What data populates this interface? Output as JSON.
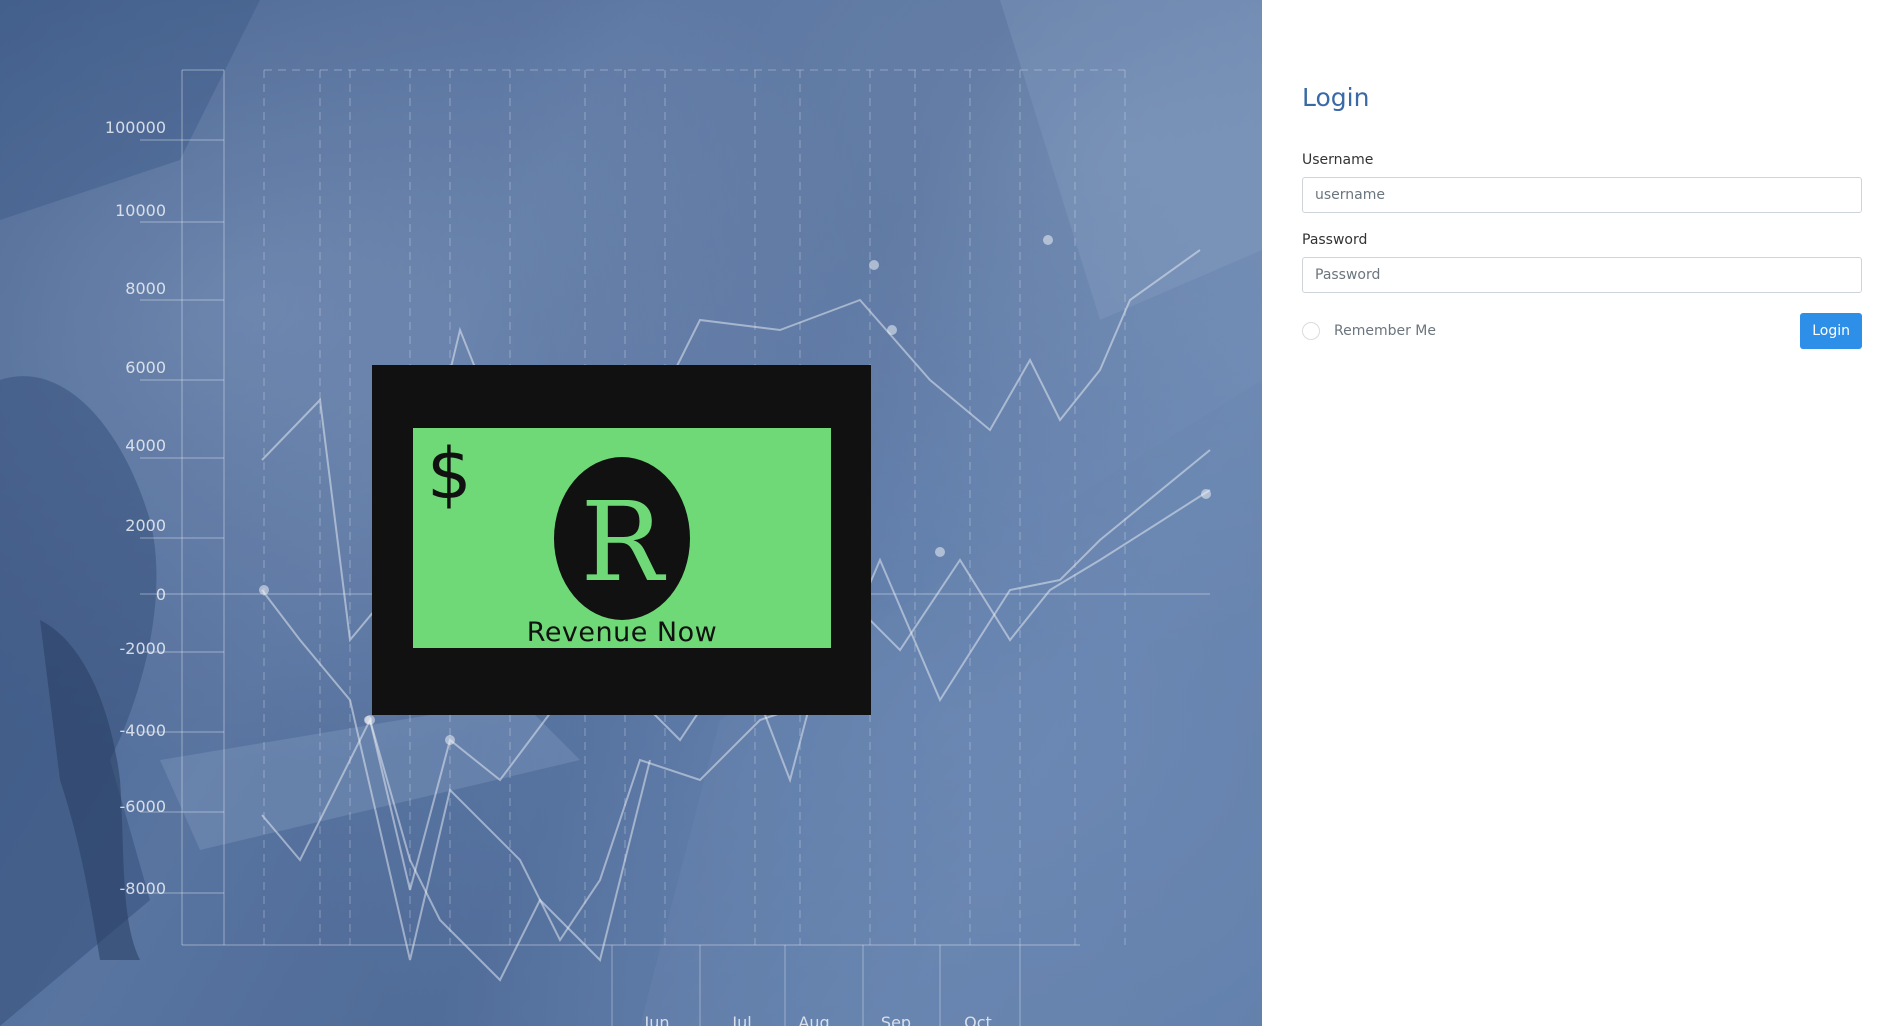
{
  "hero": {
    "background_color": "#4c6894",
    "y_axis_labels": [
      "100000",
      "10000",
      "8000",
      "6000",
      "4000",
      "2000",
      "0",
      "-2000",
      "-4000",
      "-6000",
      "-8000"
    ],
    "x_axis_labels": [
      "Jun",
      "Jul",
      "Aug",
      "Sep",
      "Oct"
    ]
  },
  "logo": {
    "dollar_symbol": "$",
    "letter": "R",
    "brand_name": "Revenue Now",
    "background_color": "#111111",
    "accent_color": "#6fd977"
  },
  "login": {
    "title": "Login",
    "username": {
      "label": "Username",
      "placeholder": "username",
      "value": ""
    },
    "password": {
      "label": "Password",
      "placeholder": "Password",
      "value": ""
    },
    "remember_me": {
      "label": "Remember Me",
      "checked": false
    },
    "submit_label": "Login",
    "title_color": "#3a6aa6",
    "button_color": "#2e8fe8"
  }
}
